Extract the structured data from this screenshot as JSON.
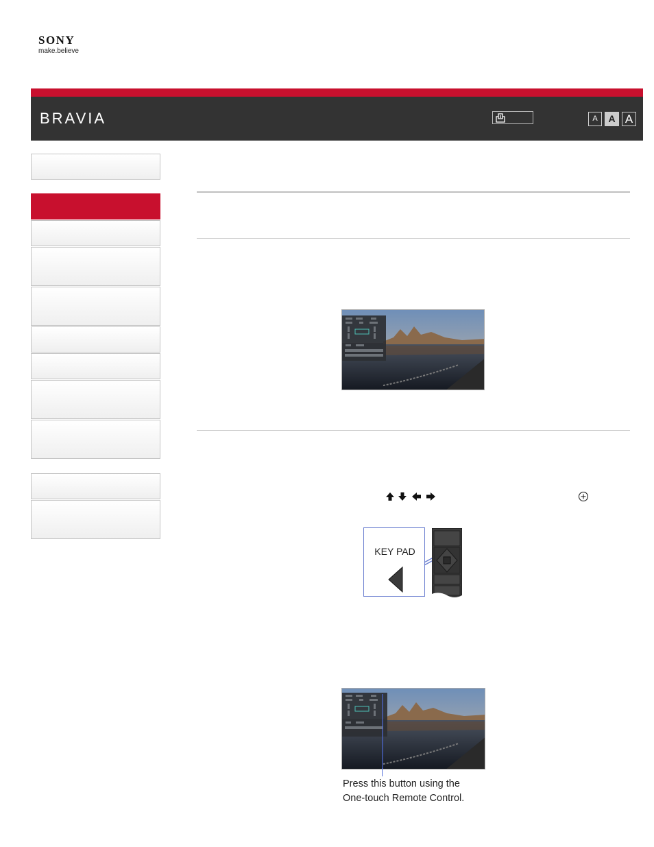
{
  "header": {
    "brand_logo": "SONY",
    "tagline": "make.believe",
    "product_logo": "BRAVIA",
    "font_size_labels": [
      "A",
      "A",
      "A"
    ],
    "accent_color": "#c8102e",
    "bar_color": "#333333"
  },
  "icons": {
    "print": "print-icon",
    "arrows": "arrow-keys-icon",
    "enter": "enter-button-icon"
  },
  "figures": {
    "key_pad_label": "KEY PAD",
    "caption_line1": "Press this button using the",
    "caption_line2": "One-touch Remote Control."
  }
}
